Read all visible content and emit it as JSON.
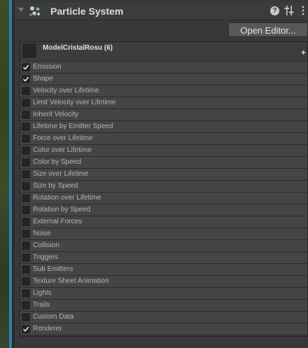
{
  "component": {
    "title": "Particle System",
    "open_editor_label": "Open Editor...",
    "help_icon_glyph": "?"
  },
  "main_module": {
    "name": "ModelCristalRosu (6)",
    "add_glyph": "+"
  },
  "modules": [
    {
      "label": "Emission",
      "checked": true
    },
    {
      "label": "Shape",
      "checked": true
    },
    {
      "label": "Velocity over Lifetime",
      "checked": false
    },
    {
      "label": "Limit Velocity over Lifetime",
      "checked": false
    },
    {
      "label": "Inherit Velocity",
      "checked": false
    },
    {
      "label": "Lifetime by Emitter Speed",
      "checked": false
    },
    {
      "label": "Force over Lifetime",
      "checked": false
    },
    {
      "label": "Color over Lifetime",
      "checked": false
    },
    {
      "label": "Color by Speed",
      "checked": false
    },
    {
      "label": "Size over Lifetime",
      "checked": false
    },
    {
      "label": "Size by Speed",
      "checked": false
    },
    {
      "label": "Rotation over Lifetime",
      "checked": false
    },
    {
      "label": "Rotation by Speed",
      "checked": false
    },
    {
      "label": "External Forces",
      "checked": false
    },
    {
      "label": "Noise",
      "checked": false
    },
    {
      "label": "Collision",
      "checked": false
    },
    {
      "label": "Triggers",
      "checked": false
    },
    {
      "label": "Sub Emitters",
      "checked": false
    },
    {
      "label": "Texture Sheet Animation",
      "checked": false
    },
    {
      "label": "Lights",
      "checked": false
    },
    {
      "label": "Trails",
      "checked": false
    },
    {
      "label": "Custom Data",
      "checked": false
    },
    {
      "label": "Renderer",
      "checked": true
    }
  ],
  "icons": {
    "fold": "triangle-down-icon",
    "component": "particle-system-icon",
    "help": "help-icon",
    "preset": "preset-sliders-icon",
    "menu": "kebab-menu-icon",
    "add": "plus-icon",
    "check": "checkmark-icon"
  },
  "colors": {
    "accent_strip": "#2f7fb0",
    "panel_bg": "#383838",
    "row_bg": "#454545",
    "text": "#b4b4b4"
  }
}
